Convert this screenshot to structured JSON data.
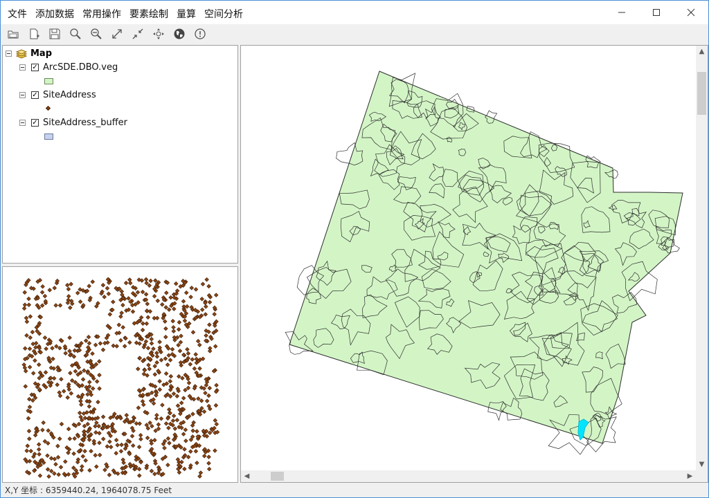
{
  "menu": [
    "文件",
    "添加数据",
    "常用操作",
    "要素绘制",
    "量算",
    "空间分析"
  ],
  "window_controls": [
    "minimize-icon",
    "maximize-icon",
    "close-icon"
  ],
  "toolbar": [
    "open-map-icon",
    "new-document-icon",
    "save-icon",
    "zoom-in-icon",
    "zoom-out-icon",
    "full-extent-icon",
    "fixed-zoom-in-icon",
    "pan-icon",
    "globe-icon",
    "identify-icon"
  ],
  "toc": {
    "root": "Map",
    "layers": [
      {
        "name": "ArcSDE.DBO.veg",
        "checked": true,
        "legend": "polygon",
        "fill": "#d3f5c6",
        "stroke": "#6a8a5a"
      },
      {
        "name": "SiteAddress",
        "checked": true,
        "legend": "point",
        "fill": "#8b4513",
        "stroke": "#3a1d08"
      },
      {
        "name": "SiteAddress_buffer",
        "checked": true,
        "legend": "polygon",
        "fill": "#c6d2ee",
        "stroke": "#6a7a9a"
      }
    ]
  },
  "colors": {
    "vegetation_fill": "#d3f5c6",
    "vegetation_outline": "#2d2d2d",
    "address_point": "#8b4513",
    "highlight": "#00e5ff"
  },
  "status": {
    "coordinates": "X,Y 坐标 : 6359440.24, 1964078.75  Feet"
  }
}
